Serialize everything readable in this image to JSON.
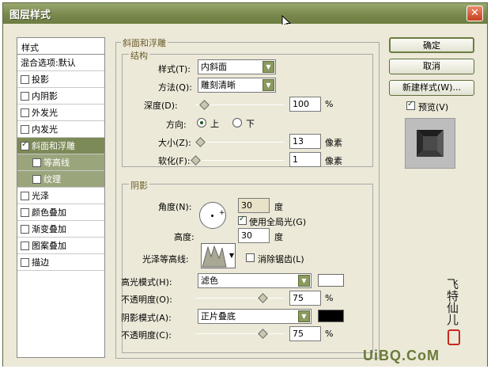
{
  "window": {
    "title": "图层样式",
    "close_glyph": "✕"
  },
  "left_panel": {
    "header": "样式",
    "items": [
      {
        "label": "混合选项:默认",
        "checkbox": false,
        "checked": false,
        "selected": false,
        "sub": false
      },
      {
        "label": "投影",
        "checkbox": true,
        "checked": false,
        "selected": false,
        "sub": false
      },
      {
        "label": "内阴影",
        "checkbox": true,
        "checked": false,
        "selected": false,
        "sub": false
      },
      {
        "label": "外发光",
        "checkbox": true,
        "checked": false,
        "selected": false,
        "sub": false
      },
      {
        "label": "内发光",
        "checkbox": true,
        "checked": false,
        "selected": false,
        "sub": false
      },
      {
        "label": "斜面和浮雕",
        "checkbox": true,
        "checked": true,
        "selected": true,
        "sub": false
      },
      {
        "label": "等高线",
        "checkbox": true,
        "checked": false,
        "selected": false,
        "sub": true
      },
      {
        "label": "纹理",
        "checkbox": true,
        "checked": false,
        "selected": false,
        "sub": true
      },
      {
        "label": "光泽",
        "checkbox": true,
        "checked": false,
        "selected": false,
        "sub": false
      },
      {
        "label": "颜色叠加",
        "checkbox": true,
        "checked": false,
        "selected": false,
        "sub": false
      },
      {
        "label": "渐变叠加",
        "checkbox": true,
        "checked": false,
        "selected": false,
        "sub": false
      },
      {
        "label": "图案叠加",
        "checkbox": true,
        "checked": false,
        "selected": false,
        "sub": false
      },
      {
        "label": "描边",
        "checkbox": true,
        "checked": false,
        "selected": false,
        "sub": false
      }
    ]
  },
  "bevel": {
    "group_title": "斜面和浮雕",
    "structure": {
      "title": "结构",
      "style_label": "样式(T):",
      "style_value": "内斜面",
      "method_label": "方法(Q):",
      "method_value": "雕刻清晰",
      "depth_label": "深度(D):",
      "depth_value": "100",
      "depth_unit": "%",
      "depth_level": 0.1,
      "direction_label": "方向:",
      "dir_up": "上",
      "dir_down": "下",
      "dir_selected": "上",
      "size_label": "大小(Z):",
      "size_value": "13",
      "size_unit": "像素",
      "size_level": 0.05,
      "soften_label": "软化(F):",
      "soften_value": "1",
      "soften_unit": "像素",
      "soften_level": 0.0
    },
    "shading": {
      "title": "阴影",
      "angle_label": "角度(N):",
      "angle_value": "30",
      "angle_unit": "度",
      "global_light_label": "使用全局光(G)",
      "global_light_checked": true,
      "altitude_label": "高度:",
      "altitude_value": "30",
      "altitude_unit": "度",
      "gloss_label": "光泽等高线:",
      "antialias_label": "消除锯齿(L)",
      "antialias_checked": false,
      "highlight_mode_label": "高光模式(H):",
      "highlight_mode_value": "滤色",
      "highlight_color": "#ffffff",
      "hl_opacity_label": "不透明度(O):",
      "hl_opacity_value": "75",
      "hl_opacity_unit": "%",
      "hl_opacity_level": 0.75,
      "shadow_mode_label": "阴影模式(A):",
      "shadow_mode_value": "正片叠底",
      "shadow_color": "#000000",
      "sh_opacity_label": "不透明度(C):",
      "sh_opacity_value": "75",
      "sh_opacity_unit": "%",
      "sh_opacity_level": 0.75
    }
  },
  "buttons": {
    "ok": "确定",
    "cancel": "取消",
    "new_style": "新建样式(W)...",
    "preview_label": "预览(V)",
    "preview_checked": true
  },
  "watermark": {
    "text": "UiBQ.CoM",
    "signature": "飞特仙儿"
  },
  "colors": {
    "title_bar": "#7a8a4e",
    "selection": "#7c8a57",
    "stamp": "#c8281e"
  }
}
